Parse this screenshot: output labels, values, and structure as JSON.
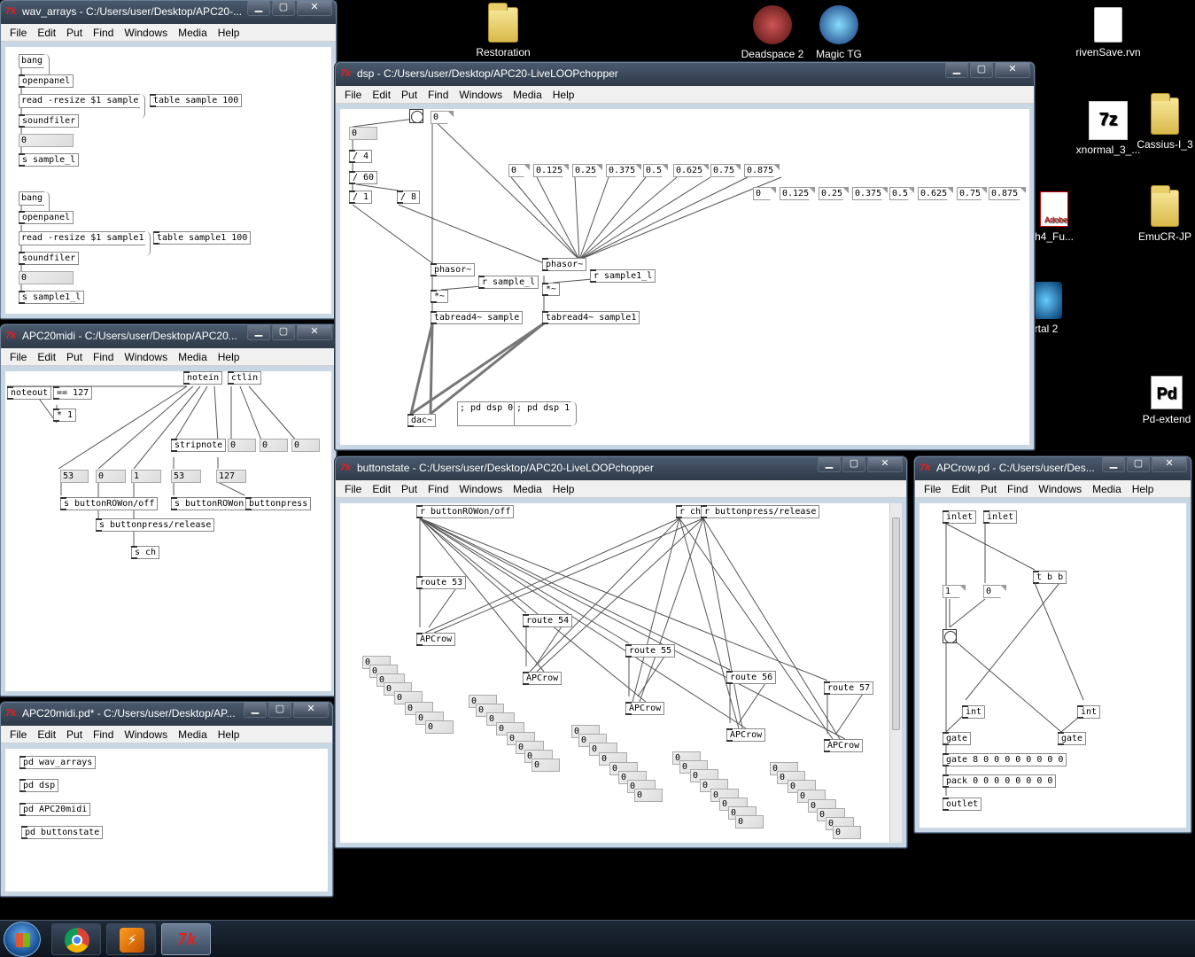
{
  "desktop": {
    "icons": [
      {
        "label": "Restoration",
        "kind": "folder"
      },
      {
        "label": "Deadspace 2",
        "kind": "app"
      },
      {
        "label": "Magic TG",
        "kind": "app"
      },
      {
        "label": "rivenSave.rvn",
        "kind": "file"
      },
      {
        "label": "xnormal_3_...",
        "kind": "app"
      },
      {
        "label": "Cassius-I_3",
        "kind": "folder"
      },
      {
        "label": "h4_Fu...",
        "kind": "pdf"
      },
      {
        "label": "EmuCR-JP",
        "kind": "folder"
      },
      {
        "label": "rtal 2",
        "kind": "app"
      },
      {
        "label": "Pd-extend",
        "kind": "app"
      }
    ]
  },
  "menu": [
    "File",
    "Edit",
    "Put",
    "Find",
    "Windows",
    "Media",
    "Help"
  ],
  "win_wav": {
    "title": "wav_arrays  - C:/Users/user/Desktop/APC20-...",
    "objects": {
      "bang1": "bang",
      "openpanel1": "openpanel",
      "read1": "read -resize $1 sample",
      "table1": "table sample 100",
      "soundfiler1": "soundfiler",
      "num1": "0",
      "send1": "s sample_l",
      "bang2": "bang",
      "openpanel2": "openpanel",
      "read2": "read -resize $1 sample1",
      "table2": "table sample1 100",
      "soundfiler2": "soundfiler",
      "num2": "0",
      "send2": "s sample1_l"
    }
  },
  "win_dsp": {
    "title": "dsp  - C:/Users/user/Desktop/APC20-LiveLOOPchopper",
    "objects": {
      "num_top": "0",
      "num_a": "0",
      "div4": "/ 4",
      "div60": "/ 60",
      "div1": "/ 1",
      "div8": "/ 8",
      "phasor1": "phasor~",
      "phasor2": "phasor~",
      "rsample": "r sample_l",
      "rsample1": "r sample1_l",
      "mul1": "*~",
      "mul2": "*~",
      "tab1": "tabread4~ sample",
      "tab2": "tabread4~ sample1",
      "dac": "dac~",
      "dsp0": "; pd dsp 0",
      "dsp1": "; pd dsp 1",
      "row1": [
        "0",
        "0.125",
        "0.25",
        "0.375",
        "0.5",
        "0.625",
        "0.75",
        "0.875"
      ],
      "row2": [
        "0",
        "0.125",
        "0.25",
        "0.375",
        "0.5",
        "0.625",
        "0.75",
        "0.875"
      ]
    }
  },
  "win_midi": {
    "title": "APC20midi  - C:/Users/user/Desktop/APC20...",
    "objects": {
      "noteout": "noteout",
      "eq127": "== 127",
      "mul1": "* 1",
      "notein": "notein",
      "ctlin": "ctlin",
      "stripnote": "stripnote",
      "n0a": "0",
      "n0b": "0",
      "n0c": "0",
      "n53a": "53",
      "n0d": "0",
      "n1": "1",
      "n53b": "53",
      "n127": "127",
      "sbtn1": "s buttonROWon/off",
      "sbtn2": "s buttonROWon",
      "btnpress": "buttonpress",
      "sbtnrel": "s buttonpress/release",
      "sch": "s ch"
    }
  },
  "win_main": {
    "title": "APC20midi.pd* - C:/Users/user/Desktop/AP...",
    "objects": [
      "pd wav_arrays",
      "pd dsp",
      "pd APC20midi",
      "pd buttonstate"
    ]
  },
  "win_btn": {
    "title": "buttonstate  - C:/Users/user/Desktop/APC20-LiveLOOPchopper",
    "objects": {
      "rrow": "r buttonROWon/off",
      "rch": "r ch",
      "rpress": "r buttonpress/release",
      "route53": "route 53",
      "route54": "route 54",
      "route55": "route 55",
      "route56": "route 56",
      "route57": "route 57",
      "apcrow": "APCrow",
      "zero": "0"
    }
  },
  "win_apcrow": {
    "title": "APCrow.pd  - C:/Users/user/Des...",
    "objects": {
      "inlet1": "inlet",
      "inlet2": "inlet",
      "tbb": "t b b",
      "n1": "1",
      "n0": "0",
      "int1": "int",
      "int2": "int",
      "gate1": "gate",
      "gate2": "gate",
      "gate8": "gate 8 0 0 0 0 0 0 0 0",
      "pack": "pack 0 0 0 0 0 0 0 0",
      "outlet": "outlet"
    }
  }
}
